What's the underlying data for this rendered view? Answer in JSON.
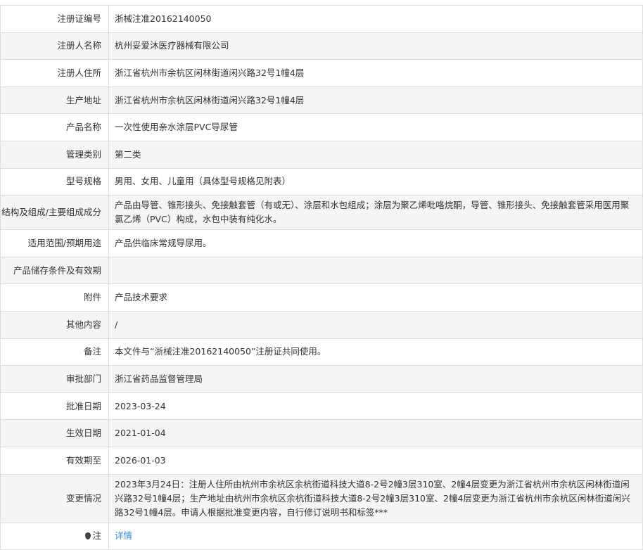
{
  "rows": [
    {
      "label": "注册证编号",
      "value": "浙械注准20162140050"
    },
    {
      "label": "注册人名称",
      "value": "杭州妥爱沐医疗器械有限公司"
    },
    {
      "label": "注册人住所",
      "value": "浙江省杭州市余杭区闲林街道闲兴路32号1幢4层"
    },
    {
      "label": "生产地址",
      "value": "浙江省杭州市余杭区闲林街道闲兴路32号1幢4层"
    },
    {
      "label": "产品名称",
      "value": "一次性使用亲水涂层PVC导尿管"
    },
    {
      "label": "管理类别",
      "value": "第二类"
    },
    {
      "label": "型号规格",
      "value": "男用、女用、儿童用（具体型号规格见附表）"
    },
    {
      "label": "结构及组成/主要组成成分",
      "value": "产品由导管、锥形接头、免接触套管（有或无）、涂层和水包组成；涂层为聚乙烯吡咯烷酮，导管、锥形接头、免接触套管采用医用聚氯乙烯（PVC）构成，水包中装有纯化水。"
    },
    {
      "label": "适用范围/预期用途",
      "value": "产品供临床常规导尿用。"
    },
    {
      "label": "产品储存条件及有效期",
      "value": ""
    },
    {
      "label": "附件",
      "value": "产品技术要求"
    },
    {
      "label": "其他内容",
      "value": "/"
    },
    {
      "label": "备注",
      "value": "本文件与“浙械注准20162140050”注册证共同使用。"
    },
    {
      "label": "审批部门",
      "value": "浙江省药品监督管理局"
    },
    {
      "label": "批准日期",
      "value": "2023-03-24"
    },
    {
      "label": "生效日期",
      "value": "2021-01-04"
    },
    {
      "label": "有效期至",
      "value": "2026-01-03"
    },
    {
      "label": "变更情况",
      "value": "2023年3月24日：注册人住所由杭州市余杭区余杭街道科技大道8-2号2幢3层310室、2幢4层变更为浙江省杭州市余杭区闲林街道闲兴路32号1幢4层；生产地址由杭州市余杭区余杭街道科技大道8-2号2幢3层310室、2幢4层变更为浙江省杭州市余杭区闲林街道闲兴路32号1幢4层。申请人根据批准变更内容，自行修订说明书和标签***"
    }
  ],
  "note": {
    "label": "注",
    "link": "详情"
  }
}
